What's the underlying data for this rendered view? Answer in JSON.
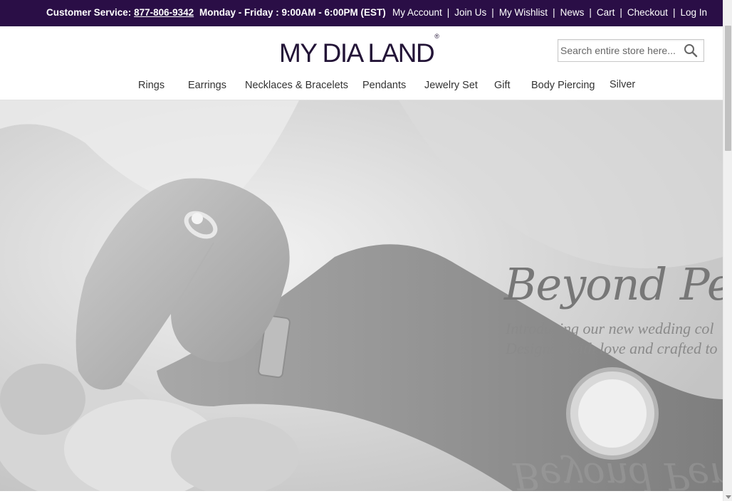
{
  "topbar": {
    "cs_label": "Customer Service:",
    "phone": "877-806-9342",
    "hours": "Monday - Friday : 9:00AM - 6:00PM (EST)",
    "links": [
      "My Account",
      "Join Us",
      "My Wishlist",
      "News",
      "Cart",
      "Checkout",
      "Log In"
    ],
    "separator": "|",
    "bg_color": "#2a0e46"
  },
  "header": {
    "logo_text": "MY DIA LAND",
    "logo_mark": "®",
    "search_placeholder": "Search entire store here...",
    "search_icon": "search-icon"
  },
  "nav": {
    "items": [
      "Rings",
      "Earrings",
      "Necklaces & Bracelets",
      "Pendants",
      "Jewelry Set",
      "Gift",
      "Body Piercing",
      "Silver"
    ]
  },
  "hero": {
    "headline": "Beyond Perf",
    "line1": "Introducing our new wedding col",
    "line2": "Designed with love and crafted to"
  }
}
